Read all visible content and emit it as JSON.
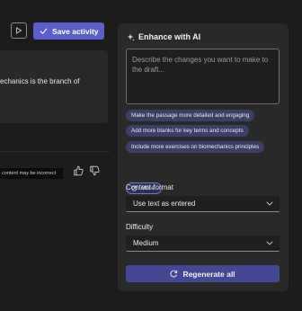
{
  "toolbar": {
    "save_label": "Save activity"
  },
  "draft": {
    "text": "echanics is the branch of",
    "disclaimer": "content may be incorrect"
  },
  "enhance": {
    "title": "Enhance with AI",
    "prompt_placeholder": "Describe the changes you want to make to the draft...",
    "suggestions": [
      "Make the passage more detailed and engaging",
      "Add more blanks for key terms and concepts",
      "Include more exercises on biomechanics principles"
    ],
    "more_label": "More",
    "content_format": {
      "label": "Content format",
      "value": "Use text as entered"
    },
    "difficulty": {
      "label": "Difficulty",
      "value": "Medium"
    },
    "regenerate_label": "Regenerate all"
  },
  "colors": {
    "accent": "#5b5fc7",
    "chip": "#3b3f65",
    "regenerate": "#444791"
  }
}
